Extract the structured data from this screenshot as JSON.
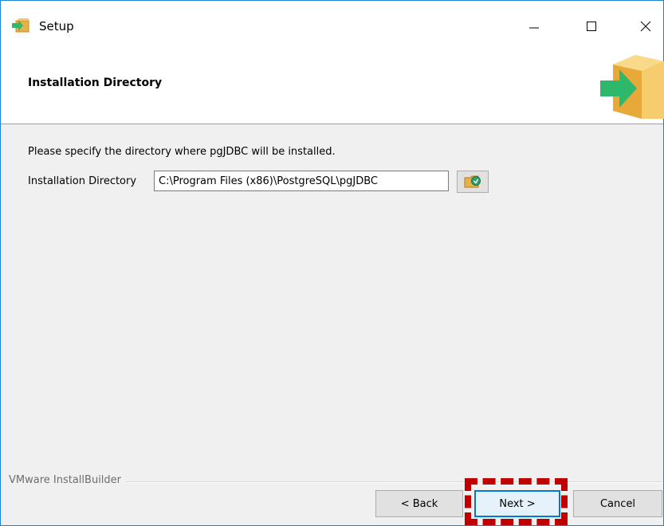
{
  "window": {
    "title": "Setup",
    "controls": {
      "minimize": "minimize-icon",
      "maximize": "maximize-icon",
      "close": "close-icon"
    }
  },
  "header": {
    "title": "Installation Directory",
    "graphic": "installer-box-arrow-icon"
  },
  "content": {
    "prompt": "Please specify the directory where pgJDBC will be installed.",
    "directory_label": "Installation Directory",
    "directory_value": "C:\\Program Files (x86)\\PostgreSQL\\pgJDBC",
    "browse_icon": "folder-browse-icon"
  },
  "footer": {
    "brand": "VMware InstallBuilder",
    "back_label": "< Back",
    "next_label": "Next >",
    "cancel_label": "Cancel"
  },
  "colors": {
    "accent": "#0078d7",
    "highlight": "#c00000"
  }
}
